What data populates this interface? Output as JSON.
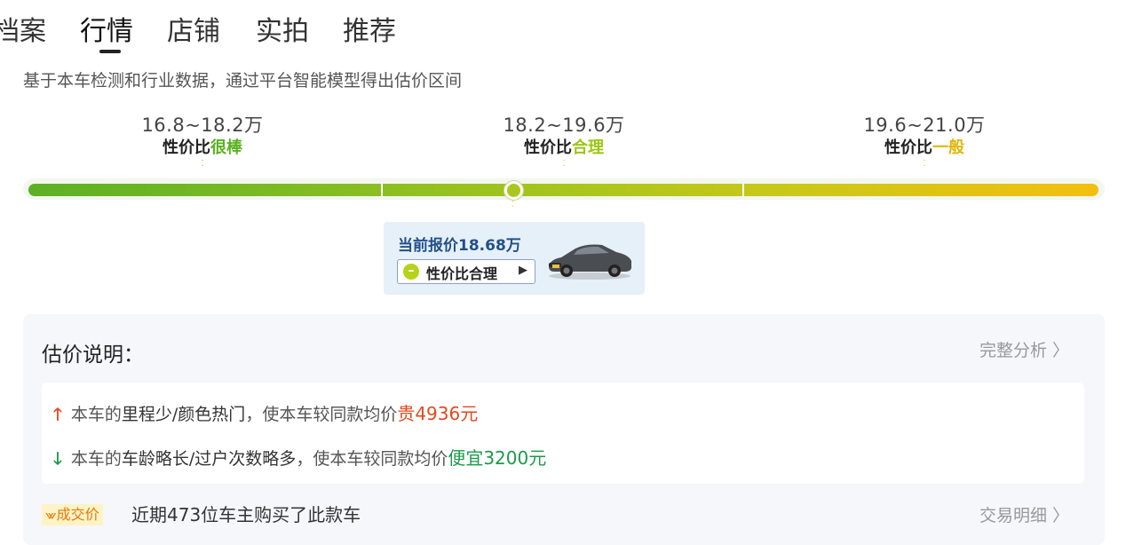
{
  "tabs": [
    {
      "label": "档案",
      "active": false
    },
    {
      "label": "行情",
      "active": true
    },
    {
      "label": "店铺",
      "active": false
    },
    {
      "label": "实拍",
      "active": false
    },
    {
      "label": "推荐",
      "active": false
    }
  ],
  "subtitle": "基于本车检测和行业数据，通过平台智能模型得出估价区间",
  "ranges": [
    {
      "price": "16.8~18.2万",
      "prefix": "性价比",
      "quality": "很棒",
      "color": "#58b21f"
    },
    {
      "price": "18.2~19.6万",
      "prefix": "性价比",
      "quality": "合理",
      "color": "#9cc614"
    },
    {
      "price": "19.6~21.0万",
      "prefix": "性价比",
      "quality": "一般",
      "color": "#e3b508"
    }
  ],
  "current": {
    "price_text": "当前报价18.68万",
    "badge_label": "性价比合理",
    "badge_arrow": "▶",
    "car_icon": "car-thumbnail"
  },
  "explain": {
    "title": "估价说明：",
    "link": "完整分析",
    "reasons": [
      {
        "arrow": "🡑",
        "pre": "本车的",
        "factors": "里程少/颜色热门",
        "mid": "，使本车较同款均价",
        "result": "贵4936元",
        "direction": "up"
      },
      {
        "arrow": "🡓",
        "pre": "本车的",
        "factors": "车龄略长/过户次数略多",
        "mid": "，使本车较同款均价",
        "result": "便宜3200元",
        "direction": "down"
      }
    ]
  },
  "deal": {
    "badge": "成交价",
    "text": "近期473位车主购买了此款车",
    "link": "交易明细"
  },
  "colors": {
    "accent_blue": "#23508a",
    "price_up": "#e04a1f",
    "price_down": "#1a9a4b",
    "bar_start": "#5cb025",
    "bar_end": "#f3bf11"
  }
}
